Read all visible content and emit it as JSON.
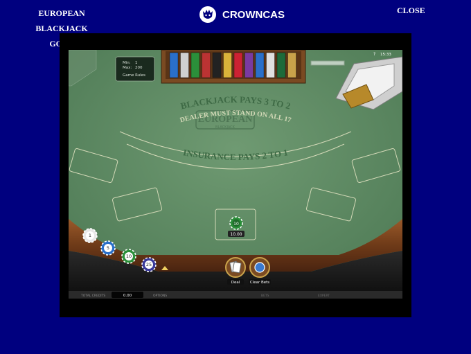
{
  "header": {
    "title_line1": "EUROPEAN BLACKJACK",
    "title_line2": "GOLD",
    "brand": "CROWNCAS",
    "close_label": "CLOSE"
  },
  "limits": {
    "min_label": "Min:",
    "min_value": "1",
    "max_label": "Max:",
    "max_value": "200",
    "rules_label": "Game Rules"
  },
  "table": {
    "logo_line1": "EUROPEAN",
    "logo_line2": "BLACKJACK",
    "arc1": "BLACKJACK PAYS 3 TO 2",
    "arc2": "DEALER MUST STAND ON ALL 17",
    "arc3": "INSURANCE PAYS 2 TO 1"
  },
  "bet": {
    "chip_value": "10",
    "amount": "10.00"
  },
  "chips": [
    {
      "value": "1",
      "color": "#e8e8e8"
    },
    {
      "value": "5",
      "color": "#2a6fc9"
    },
    {
      "value": "10",
      "color": "#2b8f3a"
    },
    {
      "value": "25",
      "color": "#3a3a9a"
    }
  ],
  "actions": {
    "deal_label": "Deal",
    "clear_label": "Clear Bets"
  },
  "status": {
    "clock": "15:33",
    "total_credits_label": "TOTAL CREDITS",
    "credits_value": "0.00",
    "options_label": "OPTIONS",
    "bet_label": "BETS",
    "expert_label": "EXPERT"
  }
}
